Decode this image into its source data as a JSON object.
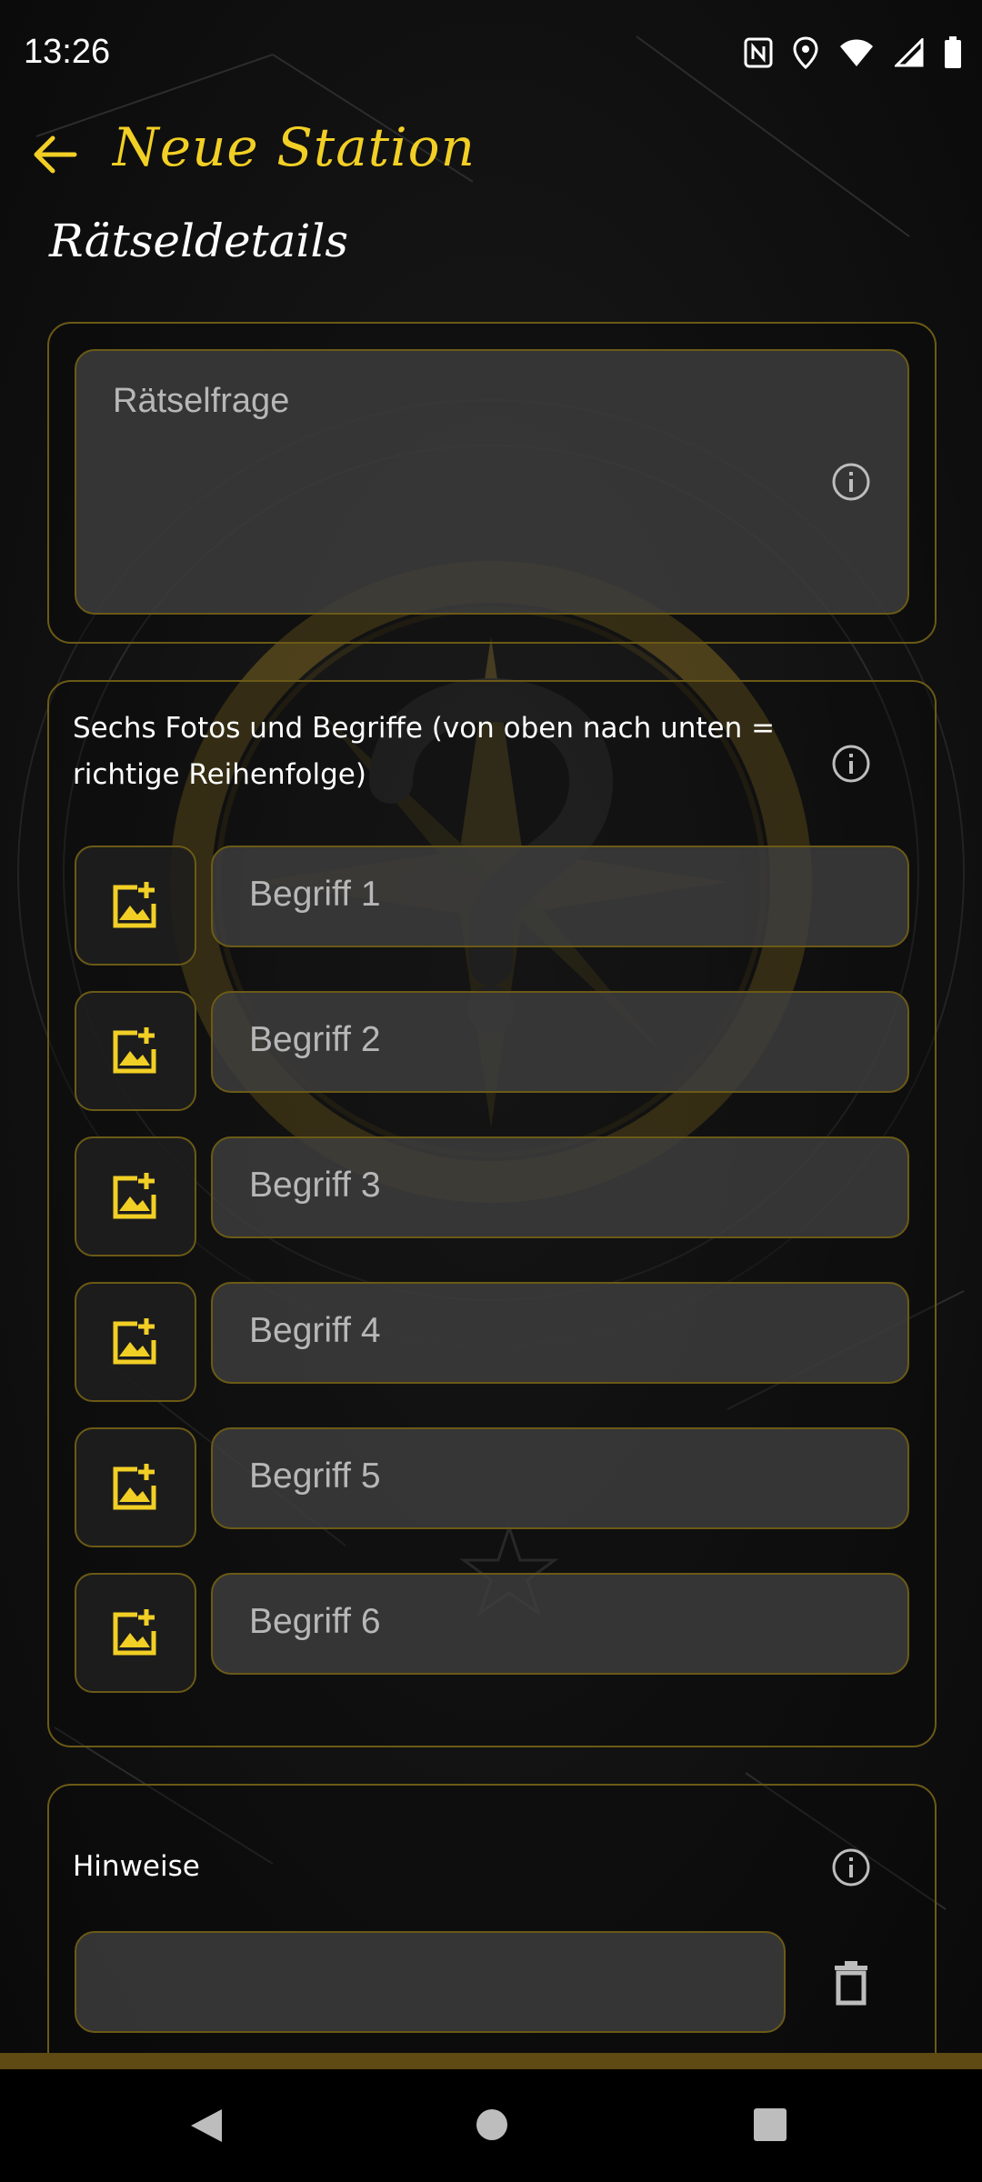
{
  "status_bar": {
    "time": "13:26",
    "icons": [
      "nfc-icon",
      "location-icon",
      "wifi-icon",
      "signal-icon",
      "battery-icon"
    ]
  },
  "app_bar": {
    "title": "Neue Station",
    "back_icon": "arrow-left-icon"
  },
  "section": {
    "title": "Rätseldetails"
  },
  "question_card": {
    "placeholder": "Rätselfrage",
    "info_icon": "info-icon"
  },
  "photos_card": {
    "label_line1": "Sechs Fotos und Begriffe (von oben nach unten =",
    "label_line2": "richtige Reihenfolge)",
    "info_icon": "info-icon",
    "items": [
      {
        "placeholder": "Begriff 1",
        "icon": "add-photo-icon"
      },
      {
        "placeholder": "Begriff 2",
        "icon": "add-photo-icon"
      },
      {
        "placeholder": "Begriff 3",
        "icon": "add-photo-icon"
      },
      {
        "placeholder": "Begriff 4",
        "icon": "add-photo-icon"
      },
      {
        "placeholder": "Begriff 5",
        "icon": "add-photo-icon"
      },
      {
        "placeholder": "Begriff 6",
        "icon": "add-photo-icon"
      }
    ]
  },
  "hints_card": {
    "label": "Hinweise",
    "info_icon": "info-icon",
    "delete_icon": "trash-icon",
    "hint_value": ""
  },
  "nav_bar": {
    "buttons": [
      "back-nav-icon",
      "home-nav-icon",
      "recents-nav-icon"
    ]
  },
  "colors": {
    "accent": "#f2cf25",
    "border": "#6b5a16",
    "field_bg": "#3e3e3e",
    "background": "#101010"
  }
}
